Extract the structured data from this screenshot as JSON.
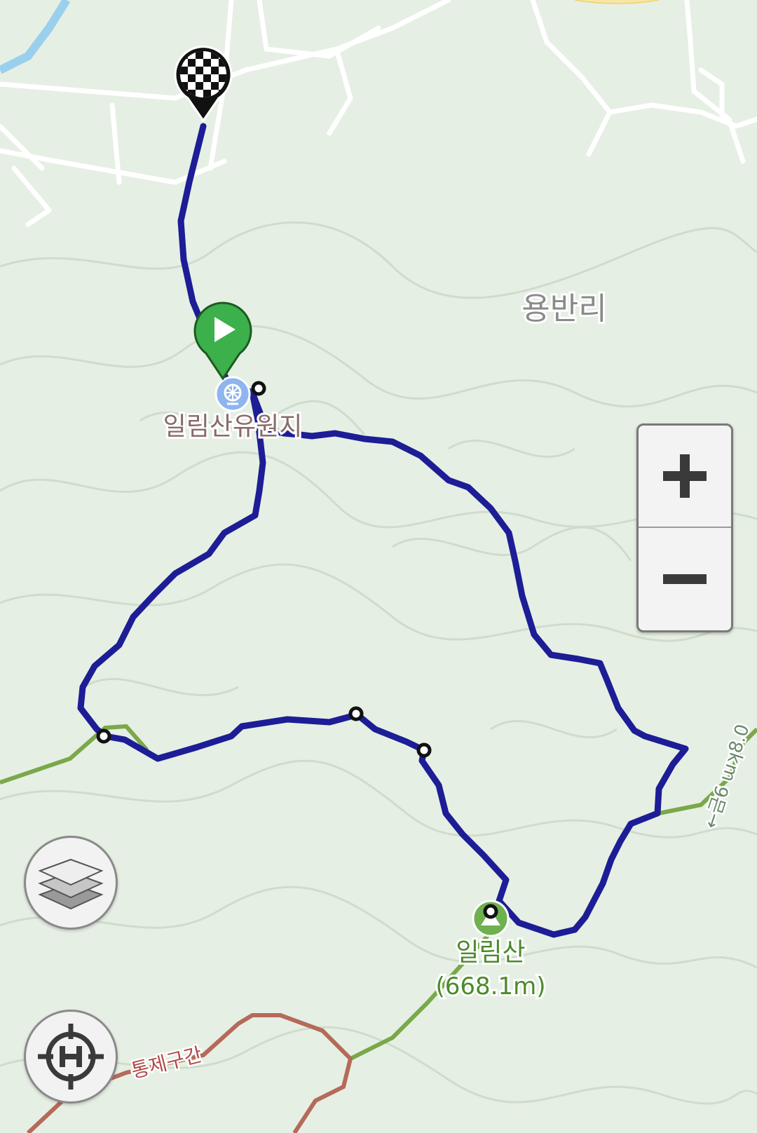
{
  "map": {
    "village_label": "용반리",
    "poi": {
      "resort_label": "일림산유원지",
      "peak_name": "일림산",
      "peak_elevation": "(668.1m)"
    },
    "trail_labels": {
      "restricted_section": "통제구간",
      "side_trail_distance": "←금6 ɯʞ8.0"
    },
    "colors": {
      "background": "#e6efe4",
      "contour": "#cfdccc",
      "road": "#ffffff",
      "route": "#1d1d96",
      "trail_green": "#7aa84a",
      "trail_restricted": "#b56a5a",
      "start_marker": "#3cb04a",
      "peak_icon": "#6fb04f"
    }
  },
  "markers": {
    "start": "play-marker",
    "finish": "checkered-flag-marker"
  },
  "controls": {
    "zoom_in_icon": "plus-icon",
    "zoom_out_icon": "minus-icon",
    "layers_icon": "layers-icon",
    "locate_icon": "location-crosshair-icon"
  }
}
